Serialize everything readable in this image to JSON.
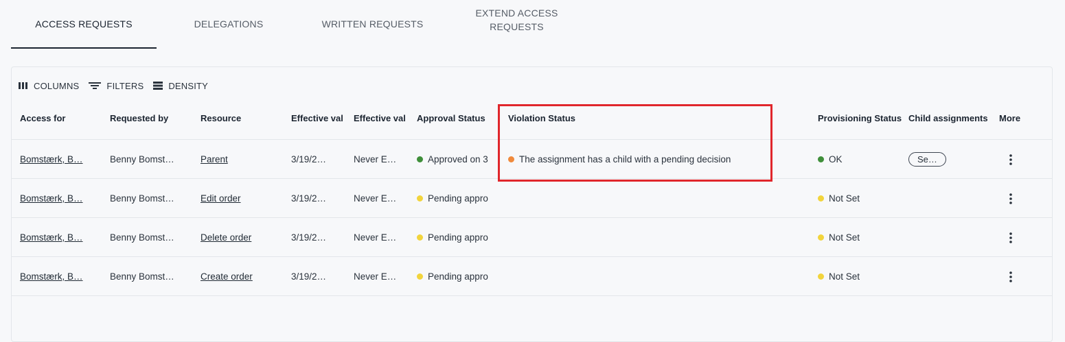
{
  "tabs": [
    {
      "label": "ACCESS REQUESTS"
    },
    {
      "label": "DELEGATIONS"
    },
    {
      "label": "WRITTEN REQUESTS"
    },
    {
      "label_line1": "EXTEND ACCESS",
      "label_line2": "REQUESTS"
    }
  ],
  "toolbar": {
    "columns": "COLUMNS",
    "filters": "FILTERS",
    "density": "DENSITY"
  },
  "columns": [
    "Access for",
    "Requested by",
    "Resource",
    "Effective val",
    "Effective val",
    "Approval Status",
    "Violation Status",
    "Provisioning Status",
    "Child assignments",
    "More"
  ],
  "rows": [
    {
      "access_for": "Bomstærk, B…",
      "requested_by": "Benny Bomst…",
      "resource": "Parent",
      "eff_from": "3/19/2…",
      "eff_to": "Never E…",
      "approval": "Approved on 3",
      "approval_color": "#3f8f3a",
      "violation": "The assignment has a child with a pending decision",
      "violation_color": "#f08a3c",
      "provisioning": "OK",
      "provisioning_color": "#3f8f3a",
      "child": "Se…"
    },
    {
      "access_for": "Bomstærk, B…",
      "requested_by": "Benny Bomst…",
      "resource": "Edit order",
      "eff_from": "3/19/2…",
      "eff_to": "Never E…",
      "approval": "Pending appro",
      "approval_color": "#f2d43c",
      "violation": "",
      "violation_color": "",
      "provisioning": "Not Set",
      "provisioning_color": "#f2d43c",
      "child": ""
    },
    {
      "access_for": "Bomstærk, B…",
      "requested_by": "Benny Bomst…",
      "resource": "Delete order",
      "eff_from": "3/19/2…",
      "eff_to": "Never E…",
      "approval": "Pending appro",
      "approval_color": "#f2d43c",
      "violation": "",
      "violation_color": "",
      "provisioning": "Not Set",
      "provisioning_color": "#f2d43c",
      "child": ""
    },
    {
      "access_for": "Bomstærk, B…",
      "requested_by": "Benny Bomst…",
      "resource": "Create order",
      "eff_from": "3/19/2…",
      "eff_to": "Never E…",
      "approval": "Pending appro",
      "approval_color": "#f2d43c",
      "violation": "",
      "violation_color": "",
      "provisioning": "Not Set",
      "provisioning_color": "#f2d43c",
      "child": ""
    }
  ],
  "colors": {
    "highlight": "#e0262b",
    "tab_indicator": "#1b2430"
  }
}
